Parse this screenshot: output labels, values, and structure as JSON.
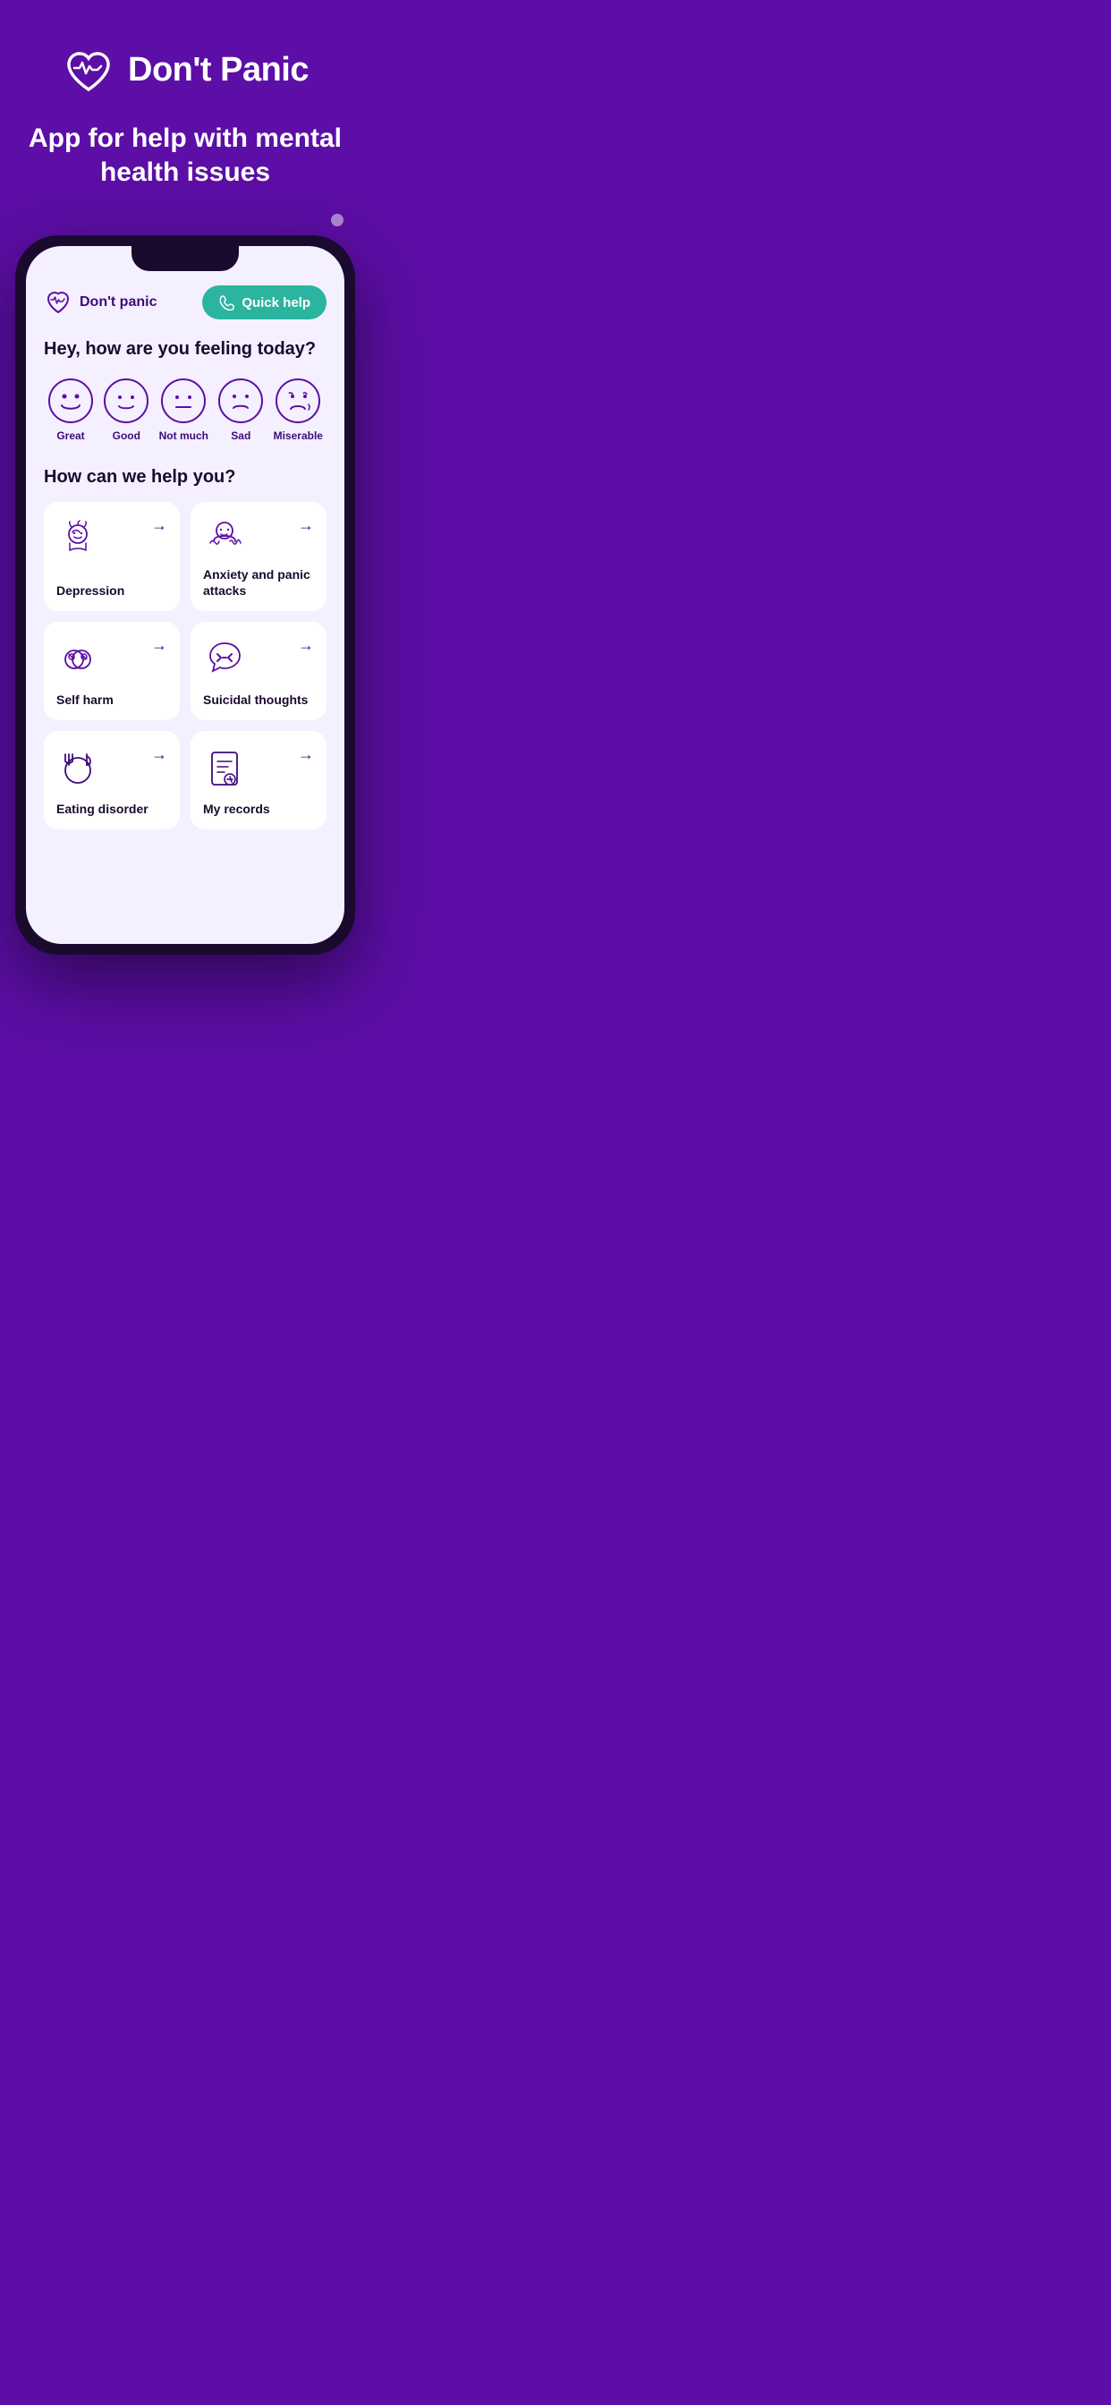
{
  "header": {
    "app_name": "Don't Panic",
    "tagline": "App for help with mental health issues",
    "dot": true
  },
  "nav": {
    "brand": "Don't panic",
    "quick_help_label": "Quick help"
  },
  "feeling": {
    "question": "Hey, how are you feeling today?",
    "moods": [
      {
        "id": "great",
        "label": "Great",
        "emoji": "😄"
      },
      {
        "id": "good",
        "label": "Good",
        "emoji": "🙂"
      },
      {
        "id": "not-much",
        "label": "Not much",
        "emoji": "😐"
      },
      {
        "id": "sad",
        "label": "Sad",
        "emoji": "😟"
      },
      {
        "id": "miserable",
        "label": "Miserable",
        "emoji": "😢"
      }
    ]
  },
  "help": {
    "question": "How can we help you?",
    "cards": [
      {
        "id": "depression",
        "label": "Depression"
      },
      {
        "id": "anxiety",
        "label": "Anxiety and panic attacks"
      },
      {
        "id": "self-harm",
        "label": "Self harm"
      },
      {
        "id": "suicidal-thoughts",
        "label": "Suicidal thoughts"
      },
      {
        "id": "eating-disorder",
        "label": "Eating disorder"
      },
      {
        "id": "my-records",
        "label": "My records"
      }
    ]
  }
}
